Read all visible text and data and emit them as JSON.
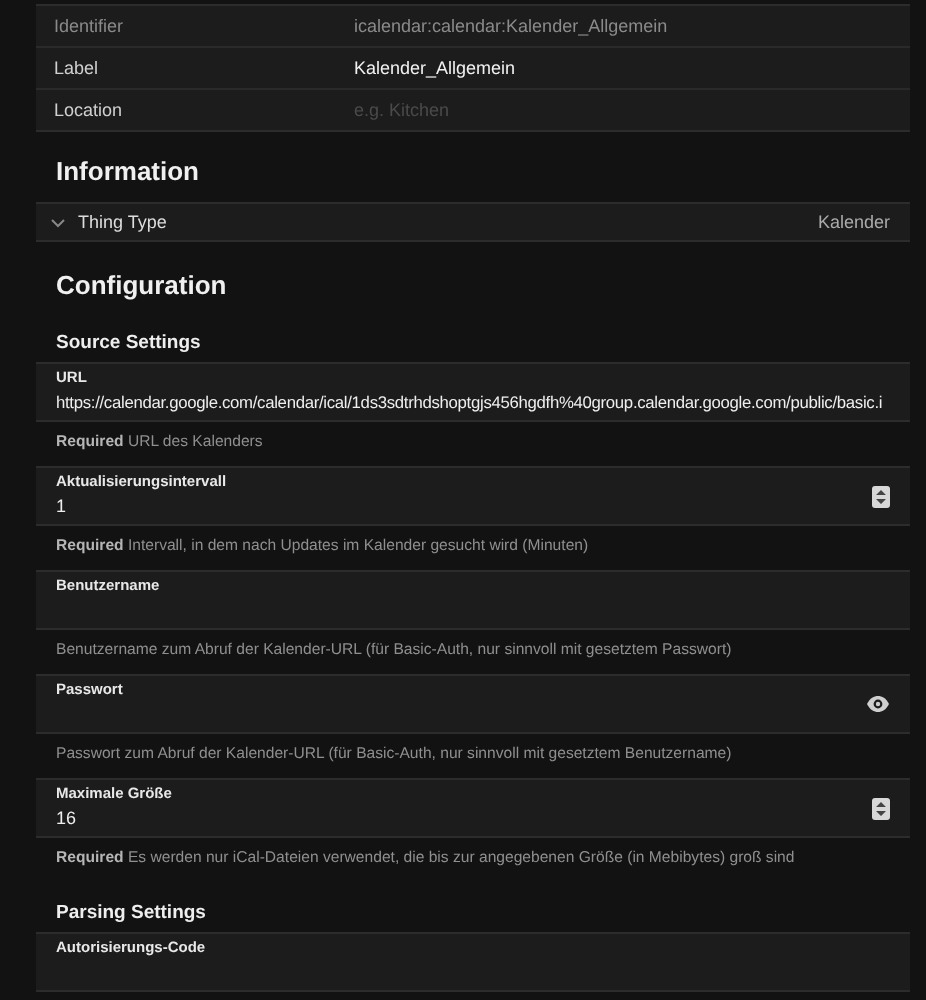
{
  "properties": [
    {
      "label": "Identifier",
      "value": "icalendar:calendar:Kalender_Allgemein",
      "disabled": true
    },
    {
      "label": "Label",
      "value": "Kalender_Allgemein",
      "disabled": false
    },
    {
      "label": "Location",
      "placeholder": "e.g. Kitchen",
      "disabled": false
    }
  ],
  "information": {
    "heading": "Information",
    "row": {
      "label": "Thing Type",
      "value": "Kalender"
    }
  },
  "configuration": {
    "heading": "Configuration",
    "groups": [
      {
        "title": "Source Settings",
        "fields": [
          {
            "kind": "text",
            "label": "URL",
            "value": "https://calendar.google.com/calendar/ical/1ds3sdtrhdshoptgjs456hgdfh%40group.calendar.google.com/public/basic.i",
            "hint": "**Required** URL des Kalenders"
          },
          {
            "kind": "number",
            "label": "Aktualisierungsintervall",
            "value": "1",
            "hint": "**Required** Intervall, in dem nach Updates im Kalender gesucht wird (Minuten)"
          },
          {
            "kind": "text",
            "label": "Benutzername",
            "hint": "Benutzername zum Abruf der Kalender-URL (für Basic-Auth, nur sinnvoll mit gesetztem Passwort)"
          },
          {
            "kind": "password",
            "label": "Passwort",
            "hint": "Passwort zum Abruf der Kalender-URL (für Basic-Auth, nur sinnvoll mit gesetztem Benutzername)"
          },
          {
            "kind": "number",
            "label": "Maximale Größe",
            "value": "16",
            "hint": "**Required** Es werden nur iCal-Dateien verwendet, die bis zur angegebenen Größe (in Mebibytes) groß sind"
          }
        ]
      },
      {
        "title": "Parsing Settings",
        "fields": [
          {
            "kind": "text",
            "label": "Autorisierungs-Code"
          }
        ]
      }
    ]
  }
}
